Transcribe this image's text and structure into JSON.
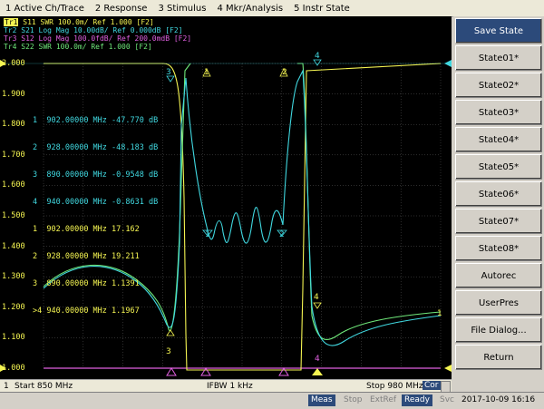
{
  "menu": [
    "1 Active Ch/Trace",
    "2 Response",
    "3 Stimulus",
    "4 Mkr/Analysis",
    "5 Instr State"
  ],
  "traces": [
    {
      "id": "Tr1",
      "label": "Tr1",
      "text": "S11  SWR 100.0m/ Ref 1.000 [F2]",
      "color": "#f5f552"
    },
    {
      "id": "Tr2",
      "label": "Tr2",
      "text": "S21  Log Mag 10.00dB/ Ref 0.000dB [F2]",
      "color": "#40d8e0"
    },
    {
      "id": "Tr3",
      "label": "Tr3",
      "text": "S12  Log Mag 100.0fdB/ Ref 200.0mdB [F2]",
      "color": "#e060e0"
    },
    {
      "id": "Tr4",
      "label": "Tr4",
      "text": "S22  SWR 100.0m/ Ref 1.000 [F2]",
      "color": "#6fe87a"
    }
  ],
  "yticks": [
    "2.000",
    "1.900",
    "1.800",
    "1.700",
    "1.600",
    "1.500",
    "1.400",
    "1.300",
    "1.200",
    "1.100",
    "1.000"
  ],
  "markers_cyan": [
    {
      "n": "1",
      "freq": "902.00000 MHz",
      "val": "-47.770 dB"
    },
    {
      "n": "2",
      "freq": "928.00000 MHz",
      "val": "-48.183 dB"
    },
    {
      "n": "3",
      "freq": "890.00000 MHz",
      "val": "-0.9548 dB"
    },
    {
      "n": "4",
      "freq": "940.00000 MHz",
      "val": "-0.8631 dB"
    }
  ],
  "markers_yellow": [
    {
      "n": "1",
      "freq": "902.00000 MHz",
      "val": "17.162"
    },
    {
      "n": "2",
      "freq": "928.00000 MHz",
      "val": "19.211"
    },
    {
      "n": "3",
      "freq": "890.00000 MHz",
      "val": "1.1391"
    },
    {
      "n": ">4",
      "freq": "940.00000 MHz",
      "val": "1.1967"
    }
  ],
  "sidebar": [
    "Save State",
    "State01*",
    "State02*",
    "State03*",
    "State04*",
    "State05*",
    "State06*",
    "State07*",
    "State08*",
    "Autorec",
    "UserPres",
    "File Dialog...",
    "Return"
  ],
  "status": {
    "channel": "1",
    "start": "Start 850 MHz",
    "ifbw": "IFBW 1 kHz",
    "stop": "Stop 980 MHz",
    "cor": "Cor"
  },
  "bottom": {
    "meas": "Meas",
    "stop": "Stop",
    "extref": "ExtRef",
    "ready": "Ready",
    "svc": "Svc",
    "datetime": "2017-10-09 16:16"
  },
  "colors": {
    "yellow": "#f5f552",
    "cyan": "#40d8e0",
    "magenta": "#e060e0",
    "green": "#6fe87a",
    "grid": "#5a5a5a"
  },
  "chart_data": {
    "type": "line",
    "x_range_mhz": [
      850,
      980
    ],
    "ylim": [
      1.0,
      2.0
    ],
    "grid": true,
    "series": [
      {
        "name": "S11",
        "color": "#f5f552"
      },
      {
        "name": "S21",
        "color": "#40d8e0"
      },
      {
        "name": "S12",
        "color": "#e060e0"
      },
      {
        "name": "S22",
        "color": "#6fe87a"
      }
    ]
  }
}
